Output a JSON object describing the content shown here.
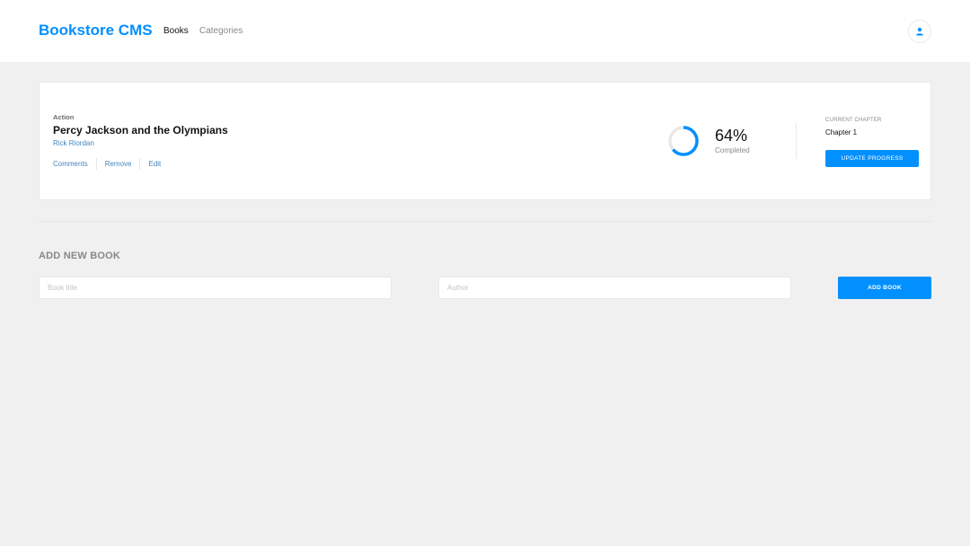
{
  "header": {
    "logo": "Bookstore CMS",
    "nav": [
      {
        "label": "Books",
        "active": true
      },
      {
        "label": "Categories",
        "active": false
      }
    ],
    "user_icon": "user-icon"
  },
  "book": {
    "genre": "Action",
    "title": "Percy Jackson and the Olympians",
    "author": "Rick Riordan",
    "actions": [
      "Comments",
      "Remove",
      "Edit"
    ],
    "progress": {
      "percent": 64,
      "percent_label": "64%",
      "status": "Completed"
    },
    "chapter": {
      "label": "CURRENT CHAPTER",
      "value": "Chapter 1",
      "button": "UPDATE PROGRESS"
    }
  },
  "form": {
    "title": "ADD NEW BOOK",
    "title_placeholder": "Book title",
    "author_placeholder": "Author",
    "button": "ADD BOOK"
  },
  "colors": {
    "accent": "#0290ff",
    "link": "#4386bf",
    "background": "#f0f0f0",
    "ring_track": "#e8e8e8"
  }
}
